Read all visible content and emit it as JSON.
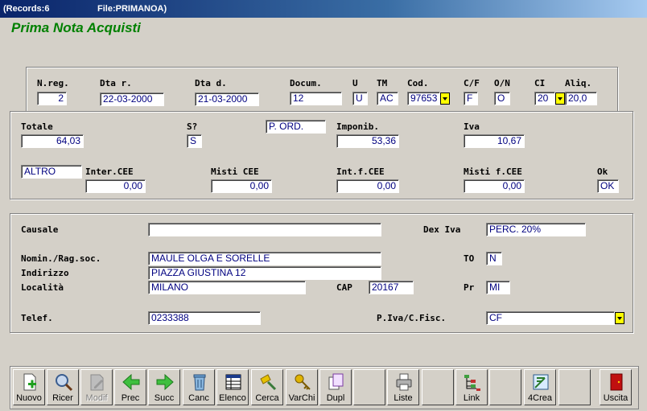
{
  "window": {
    "records": "(Records:6",
    "file": "File:PRIMANOA)"
  },
  "app_title": "Prima Nota Acquisti",
  "header": {
    "nreg": {
      "label": "N.reg.",
      "value": "2"
    },
    "dtar": {
      "label": "Dta r.",
      "value": "22-03-2000"
    },
    "dtad": {
      "label": "Dta d.",
      "value": "21-03-2000"
    },
    "docum": {
      "label": "Docum.",
      "value": "12"
    },
    "u": {
      "label": "U",
      "value": "U"
    },
    "tm": {
      "label": "TM",
      "value": "AC"
    },
    "cod": {
      "label": "Cod.",
      "value": "97653"
    },
    "cf": {
      "label": "C/F",
      "value": "F"
    },
    "on": {
      "label": "O/N",
      "value": "O"
    },
    "ci": {
      "label": "CI",
      "value": "20"
    },
    "aliq": {
      "label": "Aliq.",
      "value": "20,0"
    }
  },
  "totals": {
    "totale": {
      "label": "Totale",
      "value": "64,03"
    },
    "s": {
      "label": "S?",
      "value": "S"
    },
    "pord": {
      "value": "P. ORD."
    },
    "imponib": {
      "label": "Imponib.",
      "value": "53,36"
    },
    "iva": {
      "label": "Iva",
      "value": "10,67"
    },
    "altro": {
      "value": "ALTRO"
    },
    "intercee": {
      "label": "Inter.CEE",
      "value": "0,00"
    },
    "misticee": {
      "label": "Misti CEE",
      "value": "0,00"
    },
    "intfcee": {
      "label": "Int.f.CEE",
      "value": "0,00"
    },
    "mistifcee": {
      "label": "Misti f.CEE",
      "value": "0,00"
    },
    "ok": {
      "label": "Ok",
      "value": "OK"
    }
  },
  "details": {
    "causale": {
      "label": "Causale",
      "value": ""
    },
    "dexiva": {
      "label": "Dex Iva",
      "value": "PERC. 20%"
    },
    "nomin": {
      "label": "Nomin./Rag.soc.",
      "value": "MAULE OLGA E SORELLE"
    },
    "to": {
      "label": "TO",
      "value": "N"
    },
    "indirizzo": {
      "label": "Indirizzo",
      "value": "PIAZZA GIUSTINA 12"
    },
    "localita": {
      "label": "Località",
      "value": "MILANO"
    },
    "cap": {
      "label": "CAP",
      "value": "20167"
    },
    "pr": {
      "label": "Pr",
      "value": "MI"
    },
    "telef": {
      "label": "Telef.",
      "value": "0233388"
    },
    "piva": {
      "label": "P.Iva/C.Fisc.",
      "value": "CF"
    }
  },
  "toolbar": {
    "nuovo": "Nuovo",
    "ricer": "Ricer",
    "modif": "Modif",
    "prec": "Prec",
    "succ": "Succ",
    "canc": "Canc",
    "elenco": "Elenco",
    "cerca": "Cerca",
    "varchi": "VarChi",
    "dupl": "Dupl",
    "liste": "Liste",
    "link": "Link",
    "crea": "4Crea",
    "uscita": "Uscita"
  }
}
